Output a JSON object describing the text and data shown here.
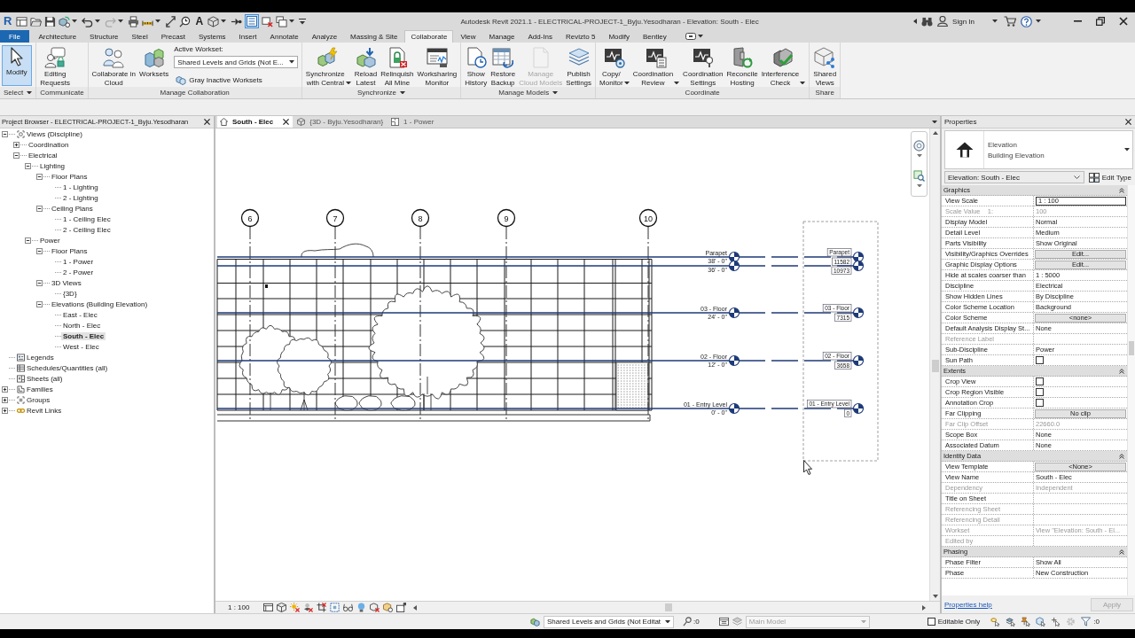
{
  "title_bar": {
    "logo": "R",
    "text_tool": "A",
    "thin_lines_on": true,
    "title": "Autodesk Revit 2021.1 - ELECTRICAL-PROJECT-1_Byju.Yesodharan - Elevation: South - Elec",
    "sign_in": "Sign In"
  },
  "ribbon_tabs": [
    {
      "label": "File",
      "kind": "file",
      "selected": false
    },
    {
      "label": "Architecture",
      "kind": "tab",
      "selected": false
    },
    {
      "label": "Structure",
      "kind": "tab",
      "selected": false
    },
    {
      "label": "Steel",
      "kind": "tab",
      "selected": false
    },
    {
      "label": "Precast",
      "kind": "tab",
      "selected": false
    },
    {
      "label": "Systems",
      "kind": "tab",
      "selected": false
    },
    {
      "label": "Insert",
      "kind": "tab",
      "selected": false
    },
    {
      "label": "Annotate",
      "kind": "tab",
      "selected": false
    },
    {
      "label": "Analyze",
      "kind": "tab",
      "selected": false
    },
    {
      "label": "Massing & Site",
      "kind": "tab",
      "selected": false
    },
    {
      "label": "Collaborate",
      "kind": "tab",
      "selected": true
    },
    {
      "label": "View",
      "kind": "tab",
      "selected": false
    },
    {
      "label": "Manage",
      "kind": "tab",
      "selected": false
    },
    {
      "label": "Add-Ins",
      "kind": "tab",
      "selected": false
    },
    {
      "label": "Revizto 5",
      "kind": "tab",
      "selected": false
    },
    {
      "label": "Modify",
      "kind": "tab",
      "selected": false
    },
    {
      "label": "Bentley",
      "kind": "tab",
      "selected": false
    }
  ],
  "ribbon_panels": [
    {
      "label": "Select",
      "menu": true,
      "tools": [
        {
          "kind": "large",
          "label": "Modify",
          "selected": true,
          "disabled": false,
          "dropdown": false
        }
      ]
    },
    {
      "label": "Communicate",
      "menu": false,
      "tools": [
        {
          "kind": "large",
          "label": "Editing\nRequests",
          "selected": false,
          "disabled": false,
          "dropdown": false
        }
      ]
    },
    {
      "label": "Manage Collaboration",
      "menu": false,
      "tools": [
        {
          "kind": "large",
          "label": "Collaborate in\nCloud",
          "selected": false,
          "disabled": false,
          "dropdown": false
        },
        {
          "kind": "large",
          "label": "Worksets",
          "selected": false,
          "disabled": false,
          "dropdown": false
        },
        {
          "kind": "workset",
          "caption": "Active Workset:",
          "value": "Shared Levels and Grids (Not E...",
          "button": "Gray Inactive Worksets"
        }
      ]
    },
    {
      "label": "Synchronize",
      "menu": true,
      "tools": [
        {
          "kind": "large",
          "label": "Synchronize\nwith Central",
          "selected": false,
          "disabled": false,
          "dropdown": true
        },
        {
          "kind": "large",
          "label": "Reload\nLatest",
          "selected": false,
          "disabled": false,
          "dropdown": false
        },
        {
          "kind": "large",
          "label": "Relinquish\nAll Mine",
          "selected": false,
          "disabled": false,
          "dropdown": false
        },
        {
          "kind": "large",
          "label": "Worksharing\nMonitor",
          "selected": false,
          "disabled": false,
          "dropdown": false
        }
      ]
    },
    {
      "label": "Manage Models",
      "menu": true,
      "tools": [
        {
          "kind": "large",
          "label": "Show\nHistory",
          "selected": false,
          "disabled": false,
          "dropdown": false
        },
        {
          "kind": "large",
          "label": "Restore\nBackup",
          "selected": false,
          "disabled": false,
          "dropdown": false
        },
        {
          "kind": "large",
          "label": "Manage\nCloud Models",
          "selected": false,
          "disabled": true,
          "dropdown": false
        },
        {
          "kind": "large",
          "label": "Publish\nSettings",
          "selected": false,
          "disabled": false,
          "dropdown": false
        }
      ]
    },
    {
      "label": "Coordinate",
      "menu": false,
      "tools": [
        {
          "kind": "large",
          "label": "Copy/\nMonitor",
          "selected": false,
          "disabled": false,
          "dropdown": true
        },
        {
          "kind": "large",
          "label": "Coordination\nReview",
          "selected": false,
          "disabled": false,
          "dropdown": true
        },
        {
          "kind": "large",
          "label": "Coordination\nSettings",
          "selected": false,
          "disabled": false,
          "dropdown": false
        },
        {
          "kind": "large",
          "label": "Reconcile\nHosting",
          "selected": false,
          "disabled": false,
          "dropdown": false
        },
        {
          "kind": "large",
          "label": "Interference\nCheck",
          "selected": false,
          "disabled": false,
          "dropdown": true
        }
      ]
    },
    {
      "label": "Share",
      "menu": false,
      "tools": [
        {
          "kind": "large",
          "label": "Shared\nViews",
          "selected": false,
          "disabled": false,
          "dropdown": false
        }
      ]
    }
  ],
  "project_browser": {
    "title": "Project Browser - ELECTRICAL-PROJECT-1_Byju.Yesodharan",
    "items": [
      {
        "label": "Views (Discipline)",
        "expanded": true,
        "selected": false,
        "children": [
          {
            "label": "Coordination",
            "expanded": false,
            "selected": false
          },
          {
            "label": "Electrical",
            "expanded": true,
            "selected": false,
            "children": [
              {
                "label": "Lighting",
                "expanded": true,
                "selected": false,
                "children": [
                  {
                    "label": "Floor Plans",
                    "expanded": true,
                    "selected": false,
                    "children": [
                      {
                        "label": "1 - Lighting",
                        "selected": false
                      },
                      {
                        "label": "2 - Lighting",
                        "selected": false
                      }
                    ]
                  },
                  {
                    "label": "Ceiling Plans",
                    "expanded": true,
                    "selected": false,
                    "children": [
                      {
                        "label": "1 - Ceiling Elec",
                        "selected": false
                      },
                      {
                        "label": "2 - Ceiling Elec",
                        "selected": false
                      }
                    ]
                  }
                ]
              },
              {
                "label": "Power",
                "expanded": true,
                "selected": false,
                "children": [
                  {
                    "label": "Floor Plans",
                    "expanded": true,
                    "selected": false,
                    "children": [
                      {
                        "label": "1 - Power",
                        "selected": false
                      },
                      {
                        "label": "2 - Power",
                        "selected": false
                      }
                    ]
                  },
                  {
                    "label": "3D Views",
                    "expanded": true,
                    "selected": false,
                    "children": [
                      {
                        "label": "{3D}",
                        "selected": false
                      }
                    ]
                  },
                  {
                    "label": "Elevations (Building Elevation)",
                    "expanded": true,
                    "selected": false,
                    "children": [
                      {
                        "label": "East - Elec",
                        "selected": false
                      },
                      {
                        "label": "North - Elec",
                        "selected": false
                      },
                      {
                        "label": "South - Elec",
                        "selected": true
                      },
                      {
                        "label": "West - Elec",
                        "selected": false
                      }
                    ]
                  }
                ]
              }
            ]
          }
        ]
      },
      {
        "label": "Legends",
        "selected": false
      },
      {
        "label": "Schedules/Quantities (all)",
        "selected": false
      },
      {
        "label": "Sheets (all)",
        "selected": false
      },
      {
        "label": "Families",
        "expanded": false,
        "selected": false
      },
      {
        "label": "Groups",
        "expanded": false,
        "selected": false
      },
      {
        "label": "Revit Links",
        "expanded": false,
        "selected": false
      }
    ]
  },
  "view": {
    "tabs": [
      {
        "label": "South - Elec",
        "selected": true
      },
      {
        "label": "{3D - Byju.Yesodharan}",
        "selected": false
      },
      {
        "label": "1 - Power",
        "selected": false
      }
    ],
    "grids": [
      "6",
      "7",
      "8",
      "9",
      "10"
    ],
    "levels": [
      {
        "name": "Parapet",
        "elevation": "38' - 0\"",
        "tag_name": "Parapet",
        "tag_value": "11582"
      },
      {
        "elevation": "36' - 0\"",
        "tag_value": "10973"
      },
      {
        "name": "03 - Floor",
        "elevation": "24' - 0\"",
        "tag_name": "03 - Floor",
        "tag_value": "7315"
      },
      {
        "name": "02 - Floor",
        "elevation": "12' - 0\"",
        "tag_name": "02 - Floor",
        "tag_value": "3658"
      },
      {
        "name": "01 - Entry Level",
        "elevation": "0' - 0\"",
        "tag_name": "01 - Entry Level",
        "tag_value": "0"
      }
    ],
    "scale": "1 : 100"
  },
  "properties": {
    "title": "Properties",
    "type_family": "Elevation",
    "type_name": "Building Elevation",
    "instance": "Elevation: South - Elec",
    "edit_type": "Edit Type",
    "groups": [
      {
        "name": "Graphics",
        "expanded": true,
        "rows": [
          {
            "label": "View Scale",
            "kind": "input",
            "value": "1 : 100",
            "disabled": false
          },
          {
            "label": "Scale Value    1:",
            "kind": "text",
            "value": "100",
            "disabled": true
          },
          {
            "label": "Display Model",
            "kind": "text",
            "value": "Normal",
            "disabled": false
          },
          {
            "label": "Detail Level",
            "kind": "text",
            "value": "Medium",
            "disabled": false
          },
          {
            "label": "Parts Visibility",
            "kind": "text",
            "value": "Show Original",
            "disabled": false
          },
          {
            "label": "Visibility/Graphics Overrides",
            "kind": "button",
            "value": "Edit...",
            "disabled": false
          },
          {
            "label": "Graphic Display Options",
            "kind": "button",
            "value": "Edit...",
            "disabled": false
          },
          {
            "label": "Hide at scales coarser than",
            "kind": "text",
            "value": "1 : 5000",
            "disabled": false
          },
          {
            "label": "Discipline",
            "kind": "text",
            "value": "Electrical",
            "disabled": false
          },
          {
            "label": "Show Hidden Lines",
            "kind": "text",
            "value": "By Discipline",
            "disabled": false
          },
          {
            "label": "Color Scheme Location",
            "kind": "text",
            "value": "Background",
            "disabled": false
          },
          {
            "label": "Color Scheme",
            "kind": "button",
            "value": "<none>",
            "disabled": false
          },
          {
            "label": "Default Analysis Display St...",
            "kind": "text",
            "value": "None",
            "disabled": false
          },
          {
            "label": "Reference Label",
            "kind": "text",
            "disabled": true
          },
          {
            "label": "Sub-Discipline",
            "kind": "text",
            "value": "Power",
            "disabled": false
          },
          {
            "label": "Sun Path",
            "kind": "checkbox",
            "checked": false,
            "disabled": false
          }
        ]
      },
      {
        "name": "Extents",
        "expanded": true,
        "rows": [
          {
            "label": "Crop View",
            "kind": "checkbox",
            "checked": false,
            "disabled": false
          },
          {
            "label": "Crop Region Visible",
            "kind": "checkbox",
            "checked": false,
            "disabled": false
          },
          {
            "label": "Annotation Crop",
            "kind": "checkbox",
            "checked": false,
            "disabled": false
          },
          {
            "label": "Far Clipping",
            "kind": "button",
            "value": "No clip",
            "disabled": false
          },
          {
            "label": "Far Clip Offset",
            "kind": "text",
            "value": "22660.0",
            "disabled": true
          },
          {
            "label": "Scope Box",
            "kind": "text",
            "value": "None",
            "disabled": false
          },
          {
            "label": "Associated Datum",
            "kind": "text",
            "value": "None",
            "disabled": false
          }
        ]
      },
      {
        "name": "Identity Data",
        "expanded": true,
        "rows": [
          {
            "label": "View Template",
            "kind": "button",
            "value": "<None>",
            "disabled": false
          },
          {
            "label": "View Name",
            "kind": "text",
            "value": "South - Elec",
            "disabled": false
          },
          {
            "label": "Dependency",
            "kind": "text",
            "value": "Independent",
            "disabled": true
          },
          {
            "label": "Title on Sheet",
            "kind": "text",
            "disabled": false
          },
          {
            "label": "Referencing Sheet",
            "kind": "text",
            "disabled": true
          },
          {
            "label": "Referencing Detail",
            "kind": "text",
            "disabled": true
          },
          {
            "label": "Workset",
            "kind": "text",
            "value": "View \"Elevation: South - El...",
            "disabled": true
          },
          {
            "label": "Edited by",
            "kind": "text",
            "disabled": true
          }
        ]
      },
      {
        "name": "Phasing",
        "expanded": true,
        "rows": [
          {
            "label": "Phase Filter",
            "kind": "text",
            "value": "Show All",
            "disabled": false
          },
          {
            "label": "Phase",
            "kind": "text",
            "value": "New Construction",
            "disabled": false
          }
        ]
      }
    ],
    "help": "Properties help",
    "apply": "Apply",
    "apply_disabled": true
  },
  "status_bar": {
    "active_workset": "Shared Levels and Grids (Not Editat",
    "editing_requests": ":0",
    "design_option": "Main Model",
    "design_option_disabled": true,
    "editable_only": "Editable Only",
    "editable_only_checked": false,
    "filter_count": ":0"
  }
}
